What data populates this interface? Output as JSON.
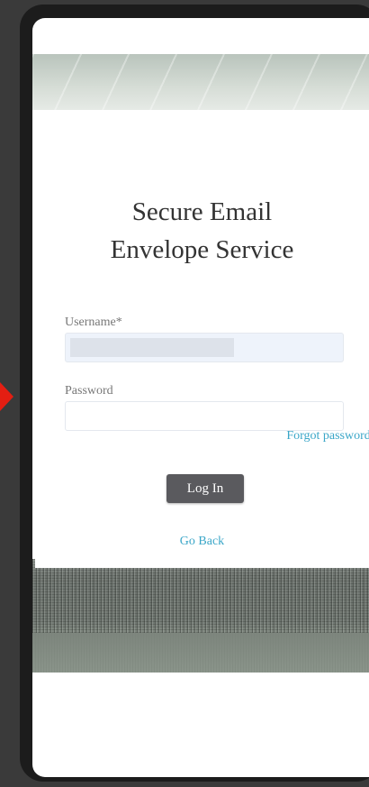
{
  "login": {
    "title_line1": "Secure Email",
    "title_line2": "Envelope Service",
    "username_label": "Username*",
    "password_label": "Password",
    "forgot_password": "Forgot password?",
    "login_button": "Log In",
    "go_back": "Go Back"
  },
  "colors": {
    "link": "#3aa6c8",
    "button_bg": "#5a5a5e",
    "pointer_arrow": "#e41e12"
  }
}
